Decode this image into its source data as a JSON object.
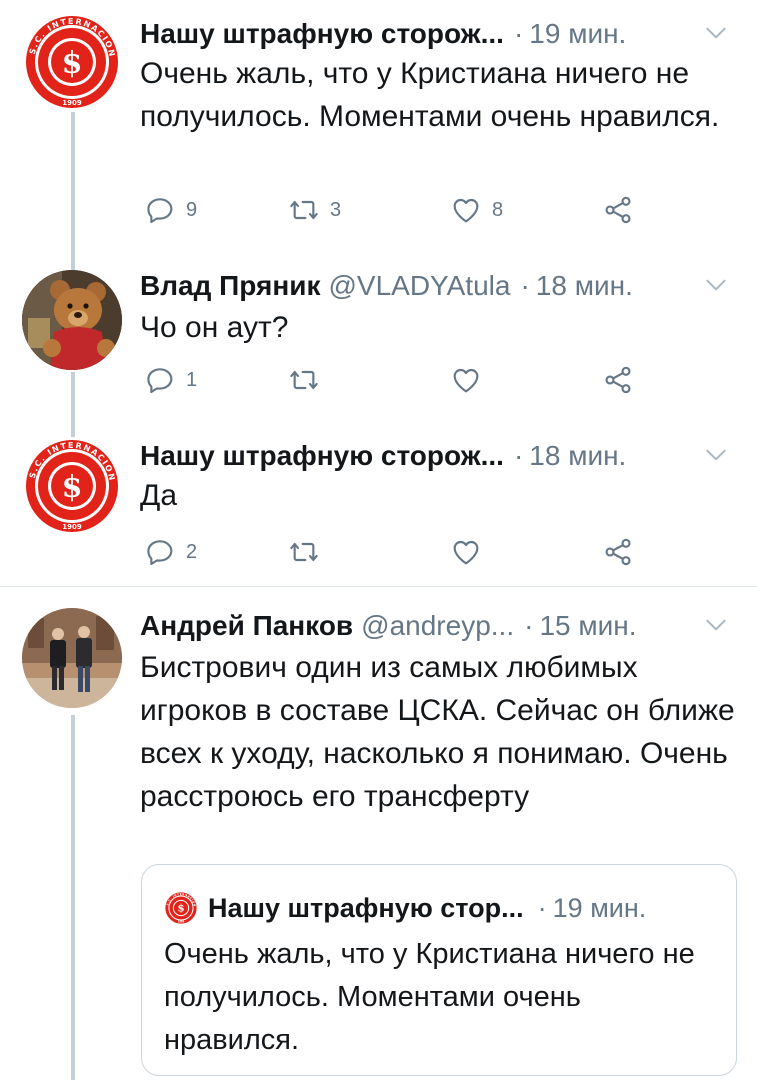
{
  "tweets": [
    {
      "name": "Нашу штрафную сторож...",
      "handle": "",
      "time": "19 мин.",
      "text": "Очень жаль, что у Кристиана ничего не получилось. Моментами очень нравился.",
      "reply_count": "9",
      "retweet_count": "3",
      "like_count": "8"
    },
    {
      "name": "Влад Пряник",
      "handle": "@VLADYAtula",
      "time": "18 мин.",
      "text": "Чо он аут?",
      "reply_count": "1",
      "retweet_count": "",
      "like_count": ""
    },
    {
      "name": "Нашу штрафную сторож...",
      "handle": "",
      "time": "18 мин.",
      "text": "Да",
      "reply_count": "2",
      "retweet_count": "",
      "like_count": ""
    },
    {
      "name": "Андрей Панков",
      "handle": "@andreyp...",
      "time": "15 мин.",
      "text": "Бистрович один из самых любимых игроков в составе ЦСКА. Сейчас он ближе всех к уходу, насколько я понимаю. Очень расстроюсь его трансферту",
      "quoted": {
        "name": "Нашу штрафную стор...",
        "time": "19 мин.",
        "text": "Очень жаль, что у Кристиана ничего не получилось. Моментами очень нравился."
      }
    }
  ],
  "separator": "·",
  "logo_text": {
    "top": "S.C. INTERNACIONAL",
    "year": "1909"
  },
  "colors": {
    "logo_red": "#e2231a",
    "secondary_text": "#657786",
    "thread_line": "#c4cfd6",
    "border": "#ccd6dd"
  },
  "icons": [
    "reply-icon",
    "retweet-icon",
    "like-icon",
    "share-icon",
    "caret-down-icon"
  ]
}
